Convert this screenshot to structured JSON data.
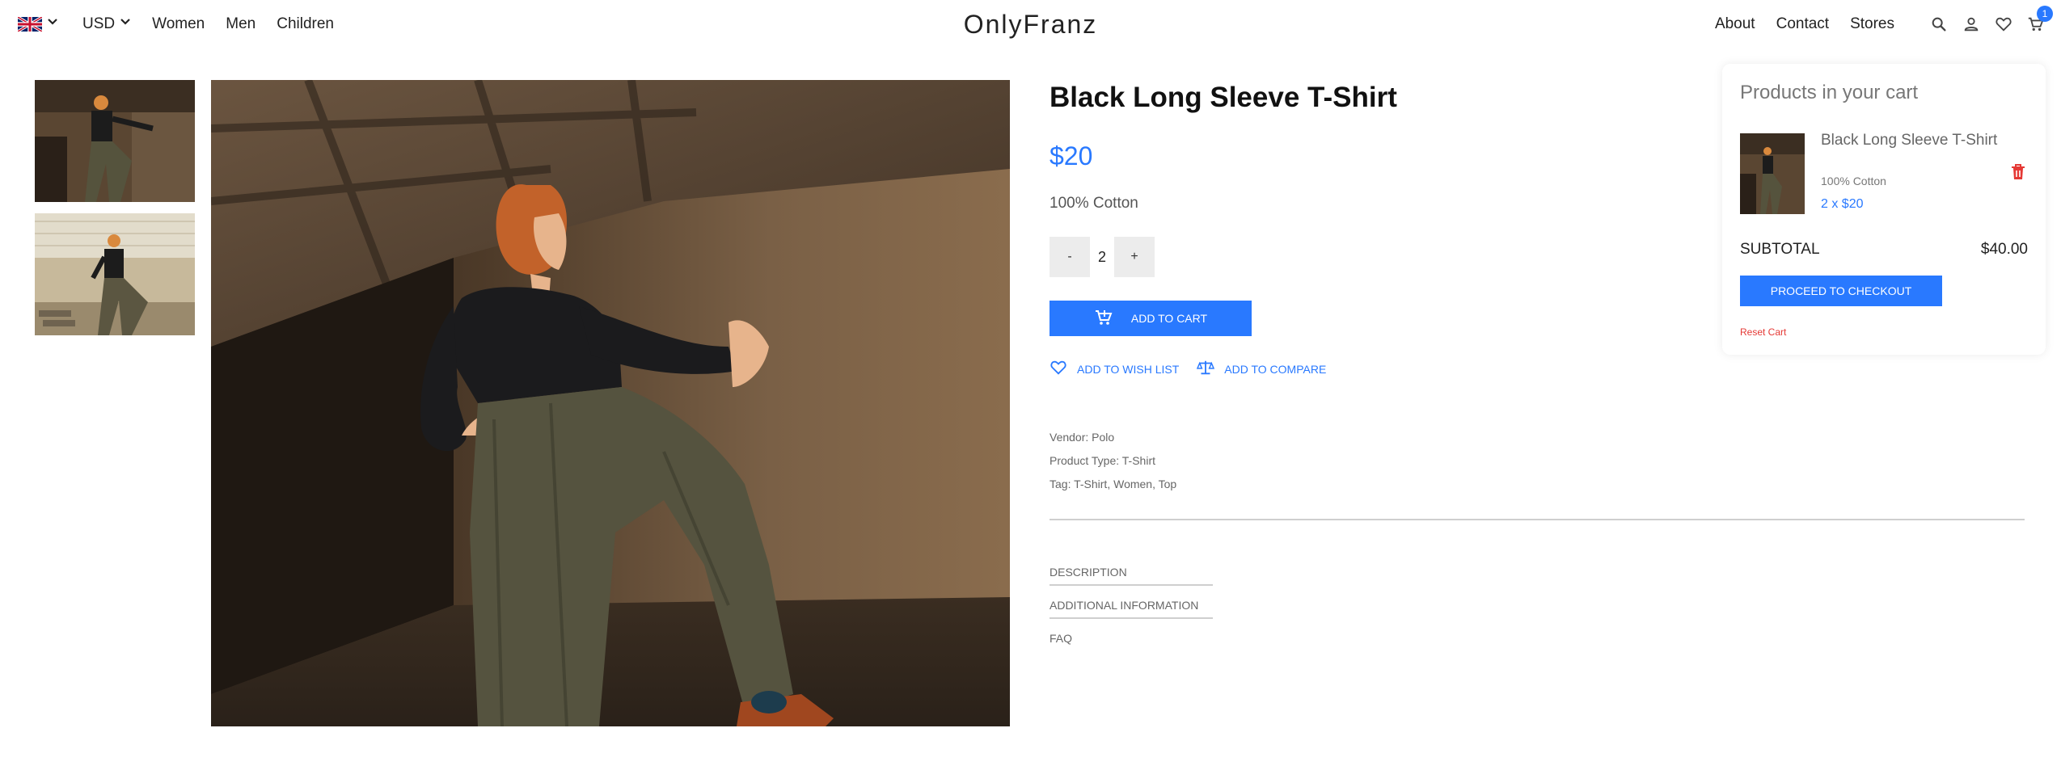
{
  "nav": {
    "currency": "USD",
    "left_links": [
      "Women",
      "Men",
      "Children"
    ],
    "brand": "OnlyFranz",
    "right_links": [
      "About",
      "Contact",
      "Stores"
    ],
    "cart_count": "1"
  },
  "product": {
    "title": "Black Long Sleeve T-Shirt",
    "price": "$20",
    "material": "100% Cotton",
    "qty_minus": "-",
    "quantity": "2",
    "qty_plus": "+",
    "add_to_cart": "ADD TO CART",
    "wish_list": "ADD TO WISH LIST",
    "compare": "ADD TO COMPARE",
    "vendor": "Vendor: Polo",
    "product_type": "Product Type: T-Shirt",
    "tags": "Tag: T-Shirt, Women, Top",
    "tabs": [
      "DESCRIPTION",
      "ADDITIONAL INFORMATION",
      "FAQ"
    ]
  },
  "cart": {
    "title": "Products in your cart",
    "item_name": "Black Long Sleeve T-Shirt",
    "item_material": "100% Cotton",
    "item_qty_price": "2 x $20",
    "subtotal_label": "SUBTOTAL",
    "subtotal_value": "$40.00",
    "checkout": "PROCEED TO CHECKOUT",
    "reset": "Reset Cart"
  },
  "colors": {
    "accent": "#2979ff",
    "danger": "#e53935"
  },
  "icons": [
    "uk-flag-icon",
    "chevron-down-icon",
    "search-icon",
    "user-icon",
    "heart-icon",
    "cart-icon",
    "cart-add-icon",
    "compare-scale-icon",
    "trash-icon"
  ]
}
